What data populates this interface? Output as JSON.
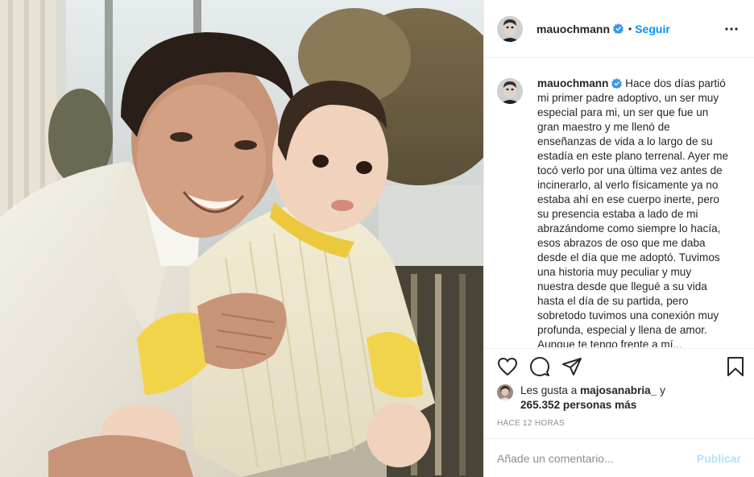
{
  "post": {
    "username": "mauochmann",
    "follow_label": "Seguir",
    "separator": "•",
    "caption": "Hace dos días partió mi primer padre adoptivo, un ser muy especial para mi, un ser que fue un gran maestro y me llenó de enseñanzas de vida a lo largo de su estadía en este plano terrenal. Ayer me tocó verlo por una última vez antes de incinerarlo, al verlo físicamente ya no estaba ahí en ese cuerpo inerte, pero su presencia estaba a lado de mi abrazándome como siempre lo hacía, esos abrazos de oso que me daba desde el día que me adoptó. Tuvimos una historia muy peculiar y muy nuestra desde que llegué a su vida hasta el día de su partida, pero sobretodo tuvimos una conexión muy profunda, especial y llena de amor. Aunque te tengo frente a mí..."
  },
  "likes": {
    "prefix": "Les gusta a",
    "liked_by": "majosanabria_",
    "conjunction": "y",
    "count": "265.352 personas más"
  },
  "timestamp": "HACE 12 HORAS",
  "comment": {
    "placeholder": "Añade un comentario...",
    "publish_label": "Publicar"
  },
  "icons": {
    "verified": "verified-badge-icon",
    "more": "more-options-icon",
    "like": "heart-icon",
    "comment": "comment-icon",
    "share": "share-icon",
    "save": "bookmark-icon"
  },
  "colors": {
    "accent": "#0095f6",
    "publish_disabled": "#b2dffc",
    "muted": "#8e8e8e",
    "text": "#262626",
    "border": "#efefef"
  }
}
